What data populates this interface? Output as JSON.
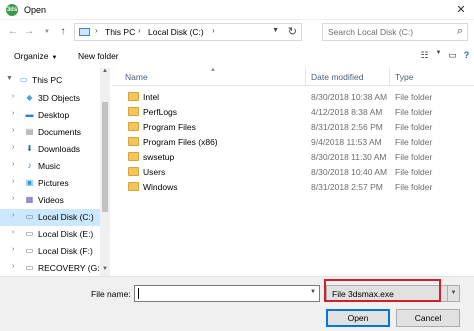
{
  "window": {
    "title": "Open",
    "app_icon": "3ds"
  },
  "address": {
    "path": [
      "This PC",
      "Local Disk (C:)"
    ],
    "search_placeholder": "Search Local Disk (C:)"
  },
  "toolbar": {
    "organize": "Organize",
    "new_folder": "New folder"
  },
  "nav": {
    "items": [
      {
        "label": "This PC",
        "icon": "pc-icon"
      },
      {
        "label": "3D Objects",
        "icon": "objects-3d-icon"
      },
      {
        "label": "Desktop",
        "icon": "desktop-icon"
      },
      {
        "label": "Documents",
        "icon": "documents-icon"
      },
      {
        "label": "Downloads",
        "icon": "downloads-icon"
      },
      {
        "label": "Music",
        "icon": "music-icon"
      },
      {
        "label": "Pictures",
        "icon": "pictures-icon"
      },
      {
        "label": "Videos",
        "icon": "videos-icon"
      },
      {
        "label": "Local Disk (C:)",
        "icon": "drive-icon"
      },
      {
        "label": "Local Disk (E:)",
        "icon": "drive-icon"
      },
      {
        "label": "Local Disk (F:)",
        "icon": "drive-icon"
      },
      {
        "label": "RECOVERY (G:)",
        "icon": "drive-icon"
      }
    ]
  },
  "files": {
    "columns": {
      "name": "Name",
      "date": "Date modified",
      "type": "Type"
    },
    "rows": [
      {
        "name": "Intel",
        "date": "8/30/2018 10:38 AM",
        "type": "File folder"
      },
      {
        "name": "PerfLogs",
        "date": "4/12/2018 8:38 AM",
        "type": "File folder"
      },
      {
        "name": "Program Files",
        "date": "8/31/2018 2:56 PM",
        "type": "File folder"
      },
      {
        "name": "Program Files (x86)",
        "date": "9/4/2018 11:53 AM",
        "type": "File folder"
      },
      {
        "name": "swsetup",
        "date": "8/30/2018 11:30 AM",
        "type": "File folder"
      },
      {
        "name": "Users",
        "date": "8/30/2018 10:40 AM",
        "type": "File folder"
      },
      {
        "name": "Windows",
        "date": "8/31/2018 2:57 PM",
        "type": "File folder"
      }
    ]
  },
  "bottom": {
    "file_name_label": "File name:",
    "file_name_value": "",
    "filter": "File 3dsmax.exe",
    "open": "Open",
    "cancel": "Cancel"
  },
  "colors": {
    "highlight": "#d0202a",
    "selected": "#cce8ff",
    "folder": "#f3c65b"
  }
}
